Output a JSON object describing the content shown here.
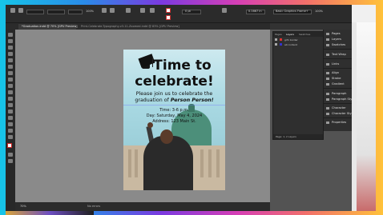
{
  "colors": {
    "frame_gradient": [
      "#16c5e8",
      "#7b3ae0",
      "#d63fb5",
      "#ffc23a"
    ],
    "app_bg": "#323232",
    "pasteboard": "#8a8a8a",
    "dome_green": "#4c8f7a"
  },
  "toolbar": {
    "zoom": "100%",
    "stroke_weight": "0 pt",
    "opacity": "100%",
    "frame_type": "Basic Graphics Frame+",
    "position_readout": "0.1667 in"
  },
  "document": {
    "active_tab": "*Graduation.indd @ 70% [GPU Preview]",
    "inactive_tab": "Print-Celebrate-Typography-v3-11-Zoomed.indd @ 83% [GPU Preview]"
  },
  "flyer": {
    "headline_line1": "Time to",
    "headline_line2": "celebrate!",
    "intro_line1": "Please join us to celebrate the",
    "intro_line2_prefix": "graduation of",
    "intro_name": "Person Person!",
    "time": "Time: 3-6 p.m.",
    "day": "Day: Saturday, May 4, 2024",
    "address": "Address: 123 Main St."
  },
  "layers_panel": {
    "tabs": [
      "Pages",
      "Layers",
      "Swatches"
    ],
    "active_tab": "Layers",
    "rows": [
      {
        "name": "grfx border"
      },
      {
        "name": "all content"
      }
    ],
    "footer": "Page: 1, 2 Layers"
  },
  "properties_panel": {
    "items": [
      {
        "label": "Pages",
        "icon": "pages-icon"
      },
      {
        "label": "Layers",
        "icon": "layers-icon"
      },
      {
        "label": "Swatches",
        "icon": "swatches-icon"
      },
      {
        "label": "Text Wrap",
        "icon": "text-wrap-icon"
      },
      {
        "label": "Links",
        "icon": "links-icon"
      },
      {
        "label": "Align",
        "icon": "align-icon"
      },
      {
        "label": "Stroke",
        "icon": "stroke-icon"
      },
      {
        "label": "Gradient",
        "icon": "gradient-icon"
      },
      {
        "label": "Paragraph",
        "icon": "paragraph-icon"
      },
      {
        "label": "Paragraph Styles",
        "icon": "paragraph-styles-icon"
      },
      {
        "label": "Character",
        "icon": "character-icon"
      },
      {
        "label": "Character Styles",
        "icon": "character-styles-icon"
      },
      {
        "label": "Properties",
        "icon": "properties-icon"
      }
    ]
  },
  "statusbar": {
    "zoom": "70%",
    "preflight": "No errors"
  }
}
